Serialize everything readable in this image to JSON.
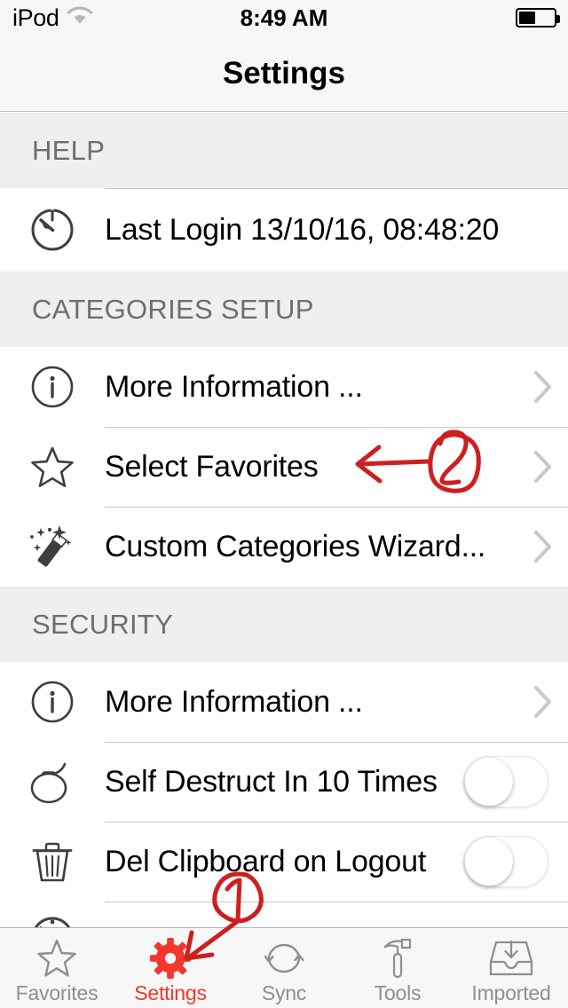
{
  "status_bar": {
    "carrier": "iPod",
    "wifi_icon": "wifi-icon",
    "time": "8:49 AM",
    "battery_icon": "battery-icon",
    "battery_percent": 45
  },
  "nav": {
    "title": "Settings"
  },
  "sections": [
    {
      "header": "HELP",
      "rows": [
        {
          "icon": "stopwatch-icon",
          "label": "Last Login 13/10/16, 08:48:20",
          "accessory": "none"
        }
      ]
    },
    {
      "header": "CATEGORIES SETUP",
      "rows": [
        {
          "icon": "info-circle-icon",
          "label": "More Information ...",
          "accessory": "chevron"
        },
        {
          "icon": "star-icon",
          "label": "Select Favorites",
          "accessory": "chevron"
        },
        {
          "icon": "magic-wand-icon",
          "label": "Custom Categories Wizard...",
          "accessory": "chevron"
        }
      ]
    },
    {
      "header": "SECURITY",
      "rows": [
        {
          "icon": "info-circle-icon",
          "label": "More Information ...",
          "accessory": "chevron"
        },
        {
          "icon": "bomb-icon",
          "label": "Self Destruct In 10 Times",
          "accessory": "switch",
          "switch_on": false
        },
        {
          "icon": "trash-icon",
          "label": "Del Clipboard on Logout",
          "accessory": "switch",
          "switch_on": false
        }
      ]
    }
  ],
  "tabs": [
    {
      "icon": "star-icon",
      "label": "Favorites",
      "active": false
    },
    {
      "icon": "gear-icon",
      "label": "Settings",
      "active": true
    },
    {
      "icon": "sync-icon",
      "label": "Sync",
      "active": false
    },
    {
      "icon": "hammer-icon",
      "label": "Tools",
      "active": false
    },
    {
      "icon": "inbox-tray-icon",
      "label": "Imported",
      "active": false
    }
  ],
  "annotations": [
    {
      "id": "anno-2",
      "text": "2",
      "shape": "circled-handwritten",
      "points_to": "Select Favorites"
    },
    {
      "id": "anno-1",
      "text": "1",
      "shape": "circled-handwritten",
      "points_to": "Settings tab"
    }
  ],
  "colors": {
    "accent_red": "#f6352b",
    "annotation_red": "#cc2020",
    "section_header_bg": "#efeff0",
    "section_header_text": "#6d6d72",
    "separator": "#c8c7cc",
    "tab_inactive": "#8e8e93",
    "icon_gray": "#4a4a4a"
  }
}
